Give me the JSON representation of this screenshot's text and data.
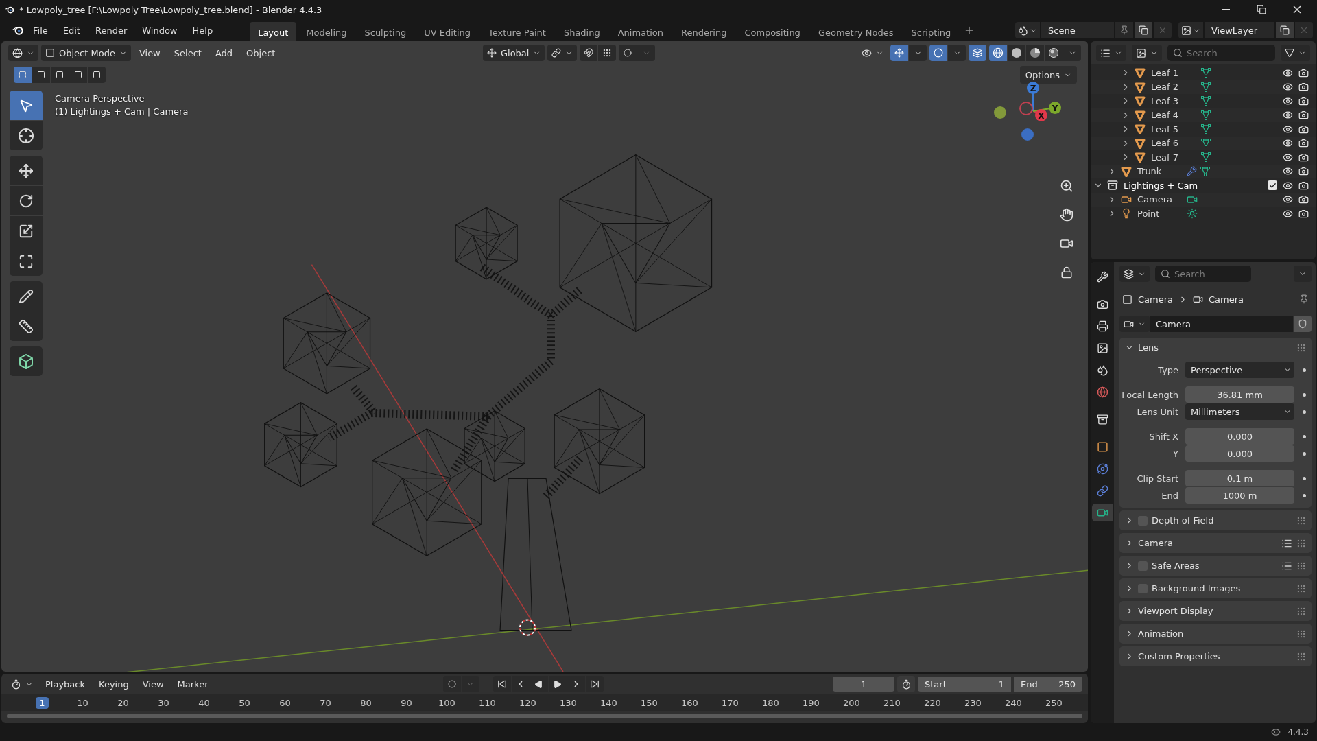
{
  "window": {
    "title": "* Lowpoly_tree [F:\\Lowpoly Tree\\Lowpoly_tree.blend] - Blender 4.4.3"
  },
  "menu": [
    "File",
    "Edit",
    "Render",
    "Window",
    "Help"
  ],
  "workspaces": [
    {
      "label": "Layout",
      "selected": true
    },
    {
      "label": "Modeling",
      "selected": false
    },
    {
      "label": "Sculpting",
      "selected": false
    },
    {
      "label": "UV Editing",
      "selected": false
    },
    {
      "label": "Texture Paint",
      "selected": false
    },
    {
      "label": "Shading",
      "selected": false
    },
    {
      "label": "Animation",
      "selected": false
    },
    {
      "label": "Rendering",
      "selected": false
    },
    {
      "label": "Compositing",
      "selected": false
    },
    {
      "label": "Geometry Nodes",
      "selected": false
    },
    {
      "label": "Scripting",
      "selected": false
    }
  ],
  "scene": "Scene",
  "view_layer": "ViewLayer",
  "viewport": {
    "mode": "Object Mode",
    "menus": [
      "View",
      "Select",
      "Add",
      "Object"
    ],
    "orientation": "Global",
    "options": "Options",
    "select_modes": [
      {
        "selected": true
      },
      {
        "selected": false
      },
      {
        "selected": false
      },
      {
        "selected": false
      },
      {
        "selected": false
      }
    ],
    "shading": [
      {
        "kind": "wireframe",
        "selected": true
      },
      {
        "kind": "solid",
        "selected": false
      },
      {
        "kind": "material",
        "selected": false
      },
      {
        "kind": "rendered",
        "selected": false
      }
    ],
    "tool_groups": [
      [
        {
          "kind": "select",
          "selected": true
        },
        {
          "kind": "cursor",
          "selected": false
        }
      ],
      [
        {
          "kind": "move",
          "selected": false
        },
        {
          "kind": "rotate",
          "selected": false
        },
        {
          "kind": "scale",
          "selected": false
        },
        {
          "kind": "transform",
          "selected": false
        }
      ],
      [
        {
          "kind": "annotate",
          "selected": false
        },
        {
          "kind": "measure",
          "selected": false
        }
      ],
      [
        {
          "kind": "add-cube",
          "selected": false
        }
      ]
    ],
    "info": [
      "Camera Perspective",
      "(1) Lightings + Cam | Camera"
    ],
    "gizmo": {
      "x": "X",
      "y": "Y",
      "z": "Z"
    }
  },
  "outliner": {
    "search_placeholder": "Search",
    "tree": [
      {
        "children": [
          {
            "children": [
              {
                "name": "Leaf 1",
                "kind": "mesh",
                "expanded": false,
                "data": [
                  {
                    "kind": "mesh"
                  }
                ]
              },
              {
                "name": "Leaf 2",
                "kind": "mesh",
                "expanded": false,
                "data": [
                  {
                    "kind": "mesh"
                  }
                ]
              },
              {
                "name": "Leaf 3",
                "kind": "mesh",
                "expanded": false,
                "data": [
                  {
                    "kind": "mesh"
                  }
                ]
              },
              {
                "name": "Leaf 4",
                "kind": "mesh",
                "expanded": false,
                "data": [
                  {
                    "kind": "mesh"
                  }
                ]
              },
              {
                "name": "Leaf 5",
                "kind": "mesh",
                "expanded": false,
                "data": [
                  {
                    "kind": "mesh"
                  }
                ]
              },
              {
                "name": "Leaf 6",
                "kind": "mesh",
                "expanded": false,
                "data": [
                  {
                    "kind": "mesh"
                  }
                ]
              },
              {
                "name": "Leaf 7",
                "kind": "mesh",
                "expanded": false,
                "data": [
                  {
                    "kind": "mesh"
                  }
                ]
              }
            ]
          },
          {
            "name": "Trunk",
            "kind": "mesh",
            "expanded": false,
            "data": [
              {
                "kind": "modifier"
              },
              {
                "kind": "mesh"
              }
            ]
          }
        ]
      },
      {
        "name": "Lightings + Cam",
        "kind": "collection",
        "expanded": true,
        "checked": true,
        "children": [
          {
            "name": "Camera",
            "kind": "camera",
            "expanded": false,
            "data": [
              {
                "kind": "camera"
              }
            ]
          },
          {
            "name": "Point",
            "kind": "light",
            "expanded": false,
            "data": [
              {
                "kind": "light"
              }
            ]
          }
        ]
      }
    ]
  },
  "properties": {
    "search_placeholder": "Search",
    "tabs": [
      {
        "kind": "tool",
        "selected": false
      },
      {
        "kind": "render",
        "selected": false
      },
      {
        "kind": "output",
        "selected": false
      },
      {
        "kind": "view-layer",
        "selected": false
      },
      {
        "kind": "scene",
        "selected": false
      },
      {
        "kind": "world",
        "selected": false
      },
      {
        "kind": "collection",
        "selected": false
      },
      {
        "kind": "object",
        "selected": false
      },
      {
        "kind": "physics",
        "selected": false
      },
      {
        "kind": "constraints",
        "selected": false
      },
      {
        "kind": "camera-data",
        "selected": true
      }
    ],
    "breadcrumb": [
      "Camera",
      "Camera"
    ],
    "datablock": "Camera",
    "panels": [
      {
        "title": "Lens",
        "expanded": true,
        "groups": [
          [
            {
              "label": "Type",
              "kind": "dropdown",
              "value": "Perspective"
            }
          ],
          [
            {
              "label": "Focal Length",
              "kind": "number",
              "value": "36.81 mm"
            },
            {
              "label": "Lens Unit",
              "kind": "dropdown",
              "value": "Millimeters"
            }
          ],
          [
            {
              "label": "Shift X",
              "kind": "number",
              "value": "0.000"
            },
            {
              "label": "Y",
              "kind": "number",
              "value": "0.000"
            }
          ],
          [
            {
              "label": "Clip Start",
              "kind": "number",
              "value": "0.1 m"
            },
            {
              "label": "End",
              "kind": "number",
              "value": "1000 m"
            }
          ]
        ]
      },
      {
        "title": "Depth of Field",
        "expanded": false,
        "checked": false
      },
      {
        "title": "Camera",
        "expanded": false,
        "presets": true
      },
      {
        "title": "Safe Areas",
        "expanded": false,
        "checked": false,
        "presets": true
      },
      {
        "title": "Background Images",
        "expanded": false,
        "checked": false
      },
      {
        "title": "Viewport Display",
        "expanded": false
      },
      {
        "title": "Animation",
        "expanded": false
      },
      {
        "title": "Custom Properties",
        "expanded": false
      }
    ]
  },
  "timeline": {
    "menus": [
      "Playback",
      "Keying",
      "View",
      "Marker"
    ],
    "current_frame": "1",
    "start_label": "Start",
    "start": "1",
    "end_label": "End",
    "end": "250",
    "ticks": [
      {
        "label": "1",
        "selected": true
      },
      {
        "label": "10",
        "selected": false
      },
      {
        "label": "20",
        "selected": false
      },
      {
        "label": "30",
        "selected": false
      },
      {
        "label": "40",
        "selected": false
      },
      {
        "label": "50",
        "selected": false
      },
      {
        "label": "60",
        "selected": false
      },
      {
        "label": "70",
        "selected": false
      },
      {
        "label": "80",
        "selected": false
      },
      {
        "label": "90",
        "selected": false
      },
      {
        "label": "100",
        "selected": false
      },
      {
        "label": "110",
        "selected": false
      },
      {
        "label": "120",
        "selected": false
      },
      {
        "label": "130",
        "selected": false
      },
      {
        "label": "140",
        "selected": false
      },
      {
        "label": "150",
        "selected": false
      },
      {
        "label": "160",
        "selected": false
      },
      {
        "label": "170",
        "selected": false
      },
      {
        "label": "180",
        "selected": false
      },
      {
        "label": "190",
        "selected": false
      },
      {
        "label": "200",
        "selected": false
      },
      {
        "label": "210",
        "selected": false
      },
      {
        "label": "220",
        "selected": false
      },
      {
        "label": "230",
        "selected": false
      },
      {
        "label": "240",
        "selected": false
      },
      {
        "label": "250",
        "selected": false
      }
    ]
  },
  "status_bar": {
    "version": "4.4.3"
  }
}
